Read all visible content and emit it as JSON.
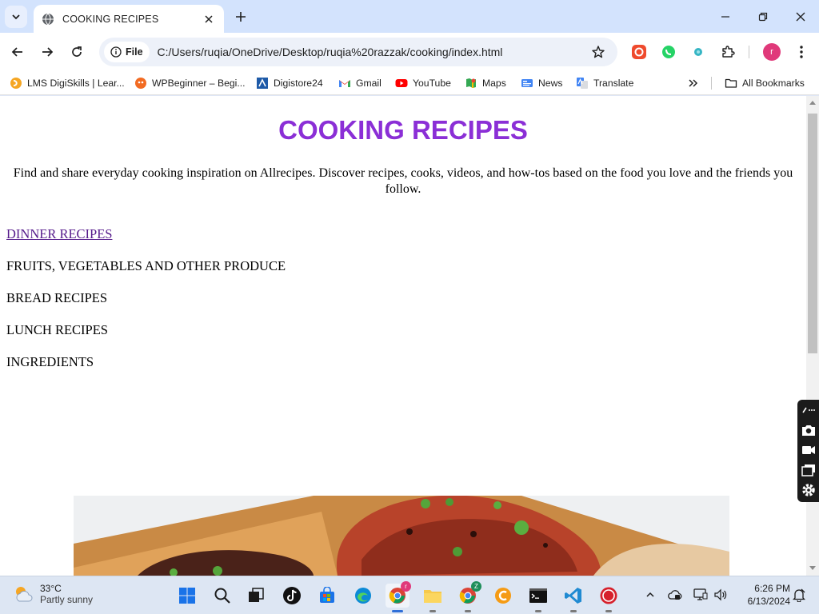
{
  "browser": {
    "tab_title": "COOKING RECIPES",
    "url_chip": "File",
    "url": "C:/Users/ruqia/OneDrive/Desktop/ruqia%20razzak/cooking/index.html",
    "profile_initial": "r"
  },
  "bookmarks": {
    "items": [
      "LMS DigiSkills | Lear...",
      "WPBeginner – Begi...",
      "Digistore24",
      "Gmail",
      "YouTube",
      "Maps",
      "News",
      "Translate"
    ],
    "all_bookmarks": "All Bookmarks"
  },
  "page": {
    "title": "COOKING RECIPES",
    "description": "Find and share everyday cooking inspiration on Allrecipes. Discover recipes, cooks, videos, and how-tos based on the food you love and the friends you follow.",
    "menu": [
      "DINNER RECIPES",
      "FRUITS, VEGETABLES AND OTHER PRODUCE",
      "BREAD RECIPES",
      "LUNCH RECIPES",
      "INGREDIENTS"
    ]
  },
  "taskbar": {
    "weather_temp": "33°C",
    "weather_desc": "Partly sunny",
    "time": "6:26 PM",
    "date": "6/13/2024",
    "chrome_badge": "r",
    "chrome2_badge": "Z"
  },
  "colors": {
    "title": "#8b2fd6",
    "visited_link": "#551a8b",
    "tab_strip": "#d3e3fd"
  }
}
